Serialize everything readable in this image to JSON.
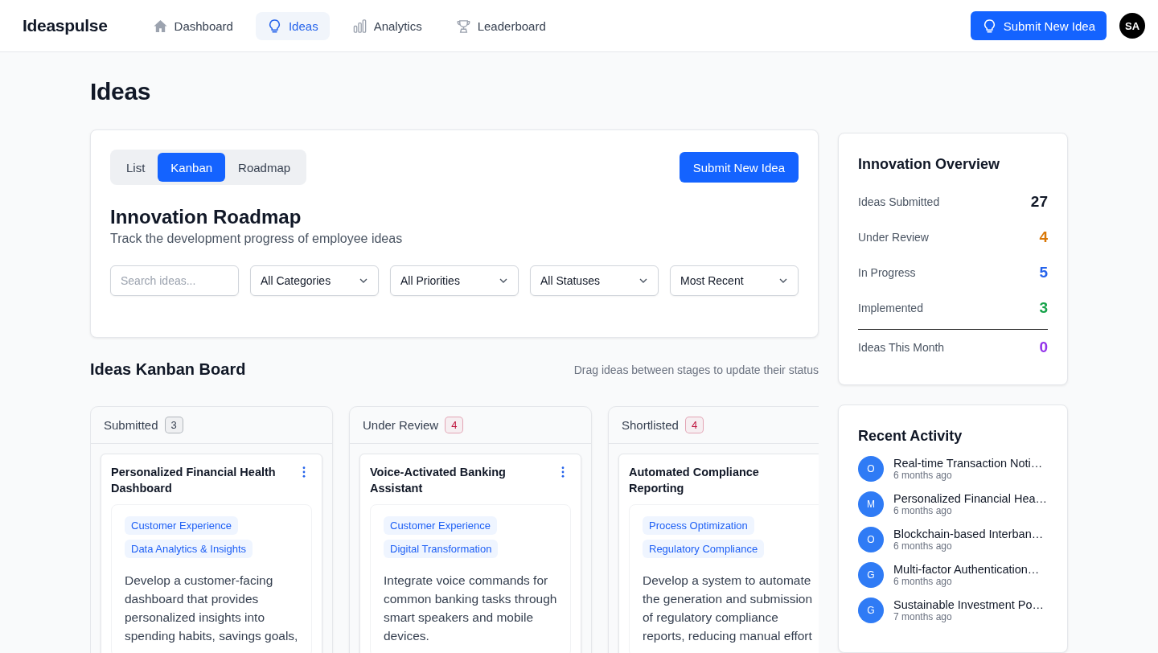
{
  "brand": "Ideaspulse",
  "nav": [
    {
      "label": "Dashboard",
      "kind": "home",
      "selected": false
    },
    {
      "label": "Ideas",
      "kind": "bulb",
      "selected": true
    },
    {
      "label": "Analytics",
      "kind": "bars",
      "selected": false
    },
    {
      "label": "Leaderboard",
      "kind": "trophy",
      "selected": false
    }
  ],
  "header_button": "Submit New Idea",
  "avatar": "SA",
  "page_title": "Ideas",
  "views": [
    {
      "label": "List",
      "selected": false
    },
    {
      "label": "Kanban",
      "selected": true
    },
    {
      "label": "Roadmap",
      "selected": false
    }
  ],
  "panel_button": "Submit New Idea",
  "roadmap": {
    "title": "Innovation Roadmap",
    "subtitle": "Track the development progress of employee ideas"
  },
  "search": {
    "placeholder": "Search ideas..."
  },
  "filters": [
    "All Categories",
    "All Priorities",
    "All Statuses",
    "Most Recent"
  ],
  "board": {
    "title": "Ideas Kanban Board",
    "hint": "Drag ideas between stages to update their status"
  },
  "columns": [
    {
      "title": "Submitted",
      "count": "3",
      "color": "#374151",
      "cards": [
        {
          "title": "Personalized Financial Health Dashboard",
          "tags": [
            "Customer Experience",
            "Data Analytics & Insights"
          ],
          "description": "Develop a customer-facing dashboard that provides personalized insights into spending habits, savings goals,"
        }
      ]
    },
    {
      "title": "Under Review",
      "count": "4",
      "color": "#be123c",
      "cards": [
        {
          "title": "Voice-Activated Banking Assistant",
          "tags": [
            "Customer Experience",
            "Digital Transformation"
          ],
          "description": "Integrate voice commands for common banking tasks through smart speakers and mobile devices."
        }
      ]
    },
    {
      "title": "Shortlisted",
      "count": "4",
      "color": "#be123c",
      "cards": [
        {
          "title": "Automated Compliance Reporting",
          "tags": [
            "Process Optimization",
            "Regulatory Compliance"
          ],
          "description": "Develop a system to automate the generation and submission of regulatory compliance reports, reducing manual effort"
        }
      ]
    }
  ],
  "overview": {
    "title": "Innovation Overview",
    "stats": [
      {
        "label": "Ideas Submitted",
        "value": "27",
        "color": "#111827"
      },
      {
        "label": "Under Review",
        "value": "4",
        "color": "#d97706"
      },
      {
        "label": "In Progress",
        "value": "5",
        "color": "#2563eb"
      },
      {
        "label": "Implemented",
        "value": "3",
        "color": "#16a34a"
      },
      {
        "label": "Ideas This Month",
        "value": "0",
        "color": "#9333ea"
      }
    ]
  },
  "activity": {
    "title": "Recent Activity",
    "items": [
      {
        "initial": "O",
        "title": "Real-time Transaction Noti…",
        "time": "6 months ago"
      },
      {
        "initial": "M",
        "title": "Personalized Financial Hea…",
        "time": "6 months ago"
      },
      {
        "initial": "O",
        "title": "Blockchain-based Interban…",
        "time": "6 months ago"
      },
      {
        "initial": "G",
        "title": "Multi-factor Authentication…",
        "time": "6 months ago"
      },
      {
        "initial": "G",
        "title": "Sustainable Investment Po…",
        "time": "7 months ago"
      }
    ]
  }
}
